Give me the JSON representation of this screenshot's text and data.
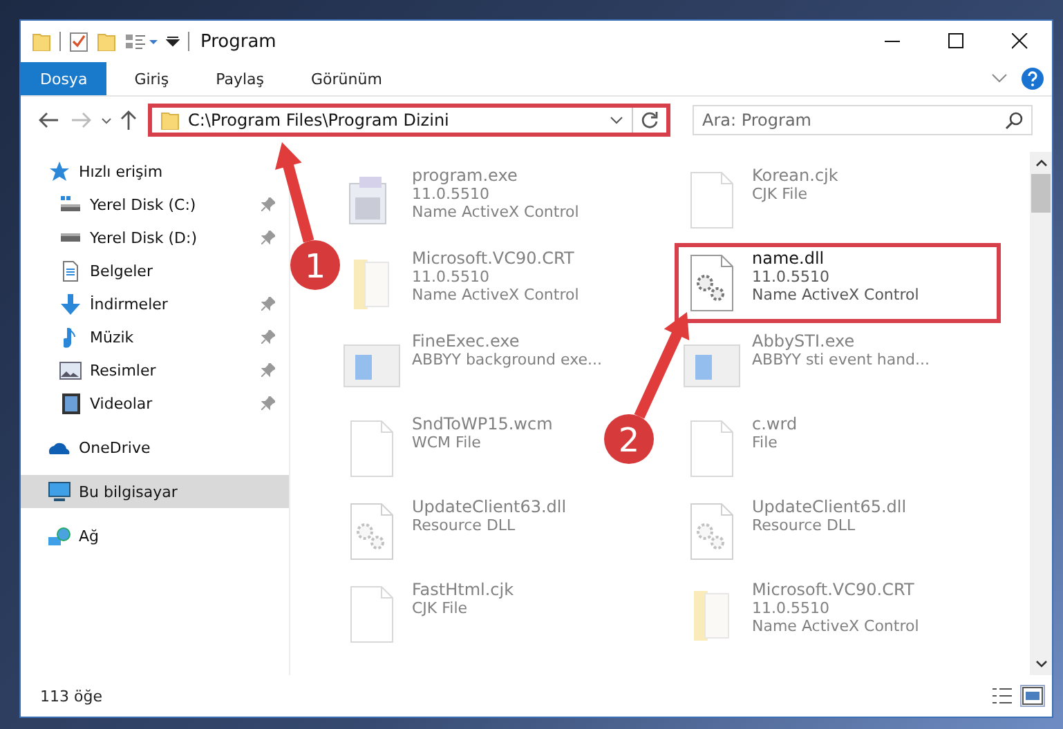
{
  "window": {
    "title": "Program"
  },
  "ribbon": {
    "tabs": [
      {
        "label": "Dosya",
        "selected": true
      },
      {
        "label": "Giriş",
        "selected": false
      },
      {
        "label": "Paylaş",
        "selected": false
      },
      {
        "label": "Görünüm",
        "selected": false
      }
    ]
  },
  "address": {
    "path": "C:\\Program Files\\Program Dizini",
    "highlighted": true
  },
  "search": {
    "placeholder": "Ara: Program"
  },
  "nav": [
    {
      "label": "Hızlı erişim",
      "kind": "star",
      "selected": false,
      "children": [
        {
          "label": "Yerel Disk (C:)",
          "kind": "diskc",
          "pinned": true,
          "selected": false
        },
        {
          "label": "Yerel Disk (D:)",
          "kind": "disk",
          "pinned": true,
          "selected": false
        },
        {
          "label": "Belgeler",
          "kind": "doc",
          "pinned": false,
          "selected": false
        },
        {
          "label": "İndirmeler",
          "kind": "download",
          "pinned": true,
          "selected": false
        },
        {
          "label": "Müzik",
          "kind": "music",
          "pinned": true,
          "selected": false
        },
        {
          "label": "Resimler",
          "kind": "picture",
          "pinned": true,
          "selected": false
        },
        {
          "label": "Videolar",
          "kind": "video",
          "pinned": true,
          "selected": false
        }
      ]
    },
    {
      "label": "OneDrive",
      "kind": "cloud",
      "selected": false
    },
    {
      "label": "Bu bilgisayar",
      "kind": "pc",
      "selected": true
    },
    {
      "label": "Ağ",
      "kind": "network",
      "selected": false
    }
  ],
  "files": [
    {
      "name": "program.exe",
      "lines": [
        "11.0.5510",
        "Name ActiveX Control"
      ],
      "kind": "exe",
      "faded": true,
      "highlighted": false
    },
    {
      "name": "Korean.cjk",
      "lines": [
        "CJK File"
      ],
      "kind": "blank",
      "faded": true,
      "highlighted": false
    },
    {
      "name": "Microsoft.VC90.CRT",
      "lines": [
        "11.0.5510",
        "Name ActiveX Control"
      ],
      "kind": "folder",
      "faded": true,
      "highlighted": false
    },
    {
      "name": "name.dll",
      "lines": [
        "11.0.5510",
        "Name ActiveX Control"
      ],
      "kind": "dll",
      "faded": false,
      "highlighted": true
    },
    {
      "name": "FineExec.exe",
      "lines": [
        "ABBYY background exe..."
      ],
      "kind": "app",
      "faded": true,
      "highlighted": false
    },
    {
      "name": "AbbySTI.exe",
      "lines": [
        "ABBYY sti event hand..."
      ],
      "kind": "app",
      "faded": true,
      "highlighted": false
    },
    {
      "name": "SndToWP15.wcm",
      "lines": [
        "WCM File"
      ],
      "kind": "blank",
      "faded": true,
      "highlighted": false
    },
    {
      "name": "c.wrd",
      "lines": [
        "File"
      ],
      "kind": "blank",
      "faded": true,
      "highlighted": false
    },
    {
      "name": "UpdateClient63.dll",
      "lines": [
        "Resource DLL"
      ],
      "kind": "dll",
      "faded": true,
      "highlighted": false
    },
    {
      "name": "UpdateClient65.dll",
      "lines": [
        "Resource DLL"
      ],
      "kind": "dll",
      "faded": true,
      "highlighted": false
    },
    {
      "name": "FastHtml.cjk",
      "lines": [
        "CJK File"
      ],
      "kind": "blank",
      "faded": true,
      "highlighted": false
    },
    {
      "name": "Microsoft.VC90.CRT",
      "lines": [
        "11.0.5510",
        "Name ActiveX Control"
      ],
      "kind": "folder",
      "faded": true,
      "highlighted": false
    }
  ],
  "status_bar": {
    "count": "113 öğe"
  },
  "annotations": [
    {
      "label": "1"
    },
    {
      "label": "2"
    }
  ]
}
